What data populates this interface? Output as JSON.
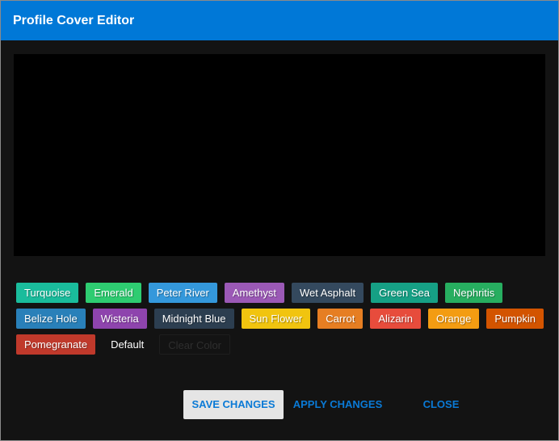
{
  "window": {
    "title": "Profile Cover Editor"
  },
  "swatches": [
    {
      "label": "Turquoise",
      "color": "#1abc9c"
    },
    {
      "label": "Emerald",
      "color": "#2ecc71"
    },
    {
      "label": "Peter River",
      "color": "#3498db"
    },
    {
      "label": "Amethyst",
      "color": "#9b59b6"
    },
    {
      "label": "Wet Asphalt",
      "color": "#34495e"
    },
    {
      "label": "Green Sea",
      "color": "#16a085"
    },
    {
      "label": "Nephritis",
      "color": "#27ae60"
    },
    {
      "label": "Belize Hole",
      "color": "#2980b9"
    },
    {
      "label": "Wisteria",
      "color": "#8e44ad"
    },
    {
      "label": "Midnight Blue",
      "color": "#2c3e50"
    },
    {
      "label": "Sun Flower",
      "color": "#f1c40f"
    },
    {
      "label": "Carrot",
      "color": "#e67e22"
    },
    {
      "label": "Alizarin",
      "color": "#e74c3c"
    },
    {
      "label": "Orange",
      "color": "#f39c12"
    },
    {
      "label": "Pumpkin",
      "color": "#d35400"
    },
    {
      "label": "Pomegranate",
      "color": "#c0392b"
    }
  ],
  "default_label": "Default",
  "clear_label": "Clear Color",
  "preview_color": "#000000",
  "footer": {
    "save": "SAVE CHANGES",
    "apply": "APPLY CHANGES",
    "close": "CLOSE"
  }
}
